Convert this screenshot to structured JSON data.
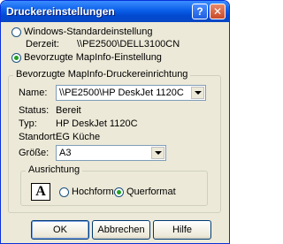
{
  "window": {
    "title": "Druckereinstellungen"
  },
  "titlebar": {
    "help_glyph": "?",
    "close_glyph": "✕"
  },
  "options": {
    "standard_label": "Windows-Standardeinstellung",
    "derzeit_label": "Derzeit:",
    "derzeit_value": "\\\\PE2500\\DELL3100CN",
    "mapinfo_label": "Bevorzugte MapInfo-Einstellung",
    "selected": "mapinfo"
  },
  "printer_group": {
    "legend": "Bevorzugte MapInfo-Druckereinrichtung",
    "name_label": "Name:",
    "name_value": "\\\\PE2500\\HP DeskJet 1120C",
    "status_label": "Status:",
    "status_value": "Bereit",
    "typ_label": "Typ:",
    "typ_value": "HP DeskJet 1120C",
    "standort_label": "Standort:",
    "standort_value": "EG Küche",
    "groesse_label": "Größe:",
    "groesse_value": "A3"
  },
  "orientation": {
    "legend": "Ausrichtung",
    "icon_glyph": "A",
    "portrait_label": "Hochformat",
    "landscape_label": "Querformat",
    "selected": "landscape"
  },
  "buttons": {
    "ok": "OK",
    "cancel": "Abbrechen",
    "help": "Hilfe"
  }
}
